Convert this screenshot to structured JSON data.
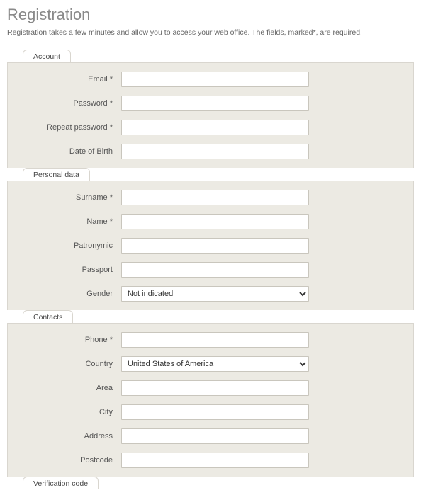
{
  "page": {
    "title": "Registration",
    "intro": "Registration takes a few minutes and allow you to access your web office. The fields, marked*, are required."
  },
  "sections": {
    "account": {
      "tab": "Account",
      "email_label": "Email *",
      "password_label": "Password *",
      "repeat_password_label": "Repeat password *",
      "dob_label": "Date of Birth"
    },
    "personal": {
      "tab": "Personal data",
      "surname_label": "Surname *",
      "name_label": "Name *",
      "patronymic_label": "Patronymic",
      "passport_label": "Passport",
      "gender_label": "Gender",
      "gender_value": "Not indicated"
    },
    "contacts": {
      "tab": "Contacts",
      "phone_label": "Phone *",
      "country_label": "Country",
      "country_value": "United States of America",
      "area_label": "Area",
      "city_label": "City",
      "address_label": "Address",
      "postcode_label": "Postcode"
    },
    "verification": {
      "tab": "Verification code"
    }
  }
}
